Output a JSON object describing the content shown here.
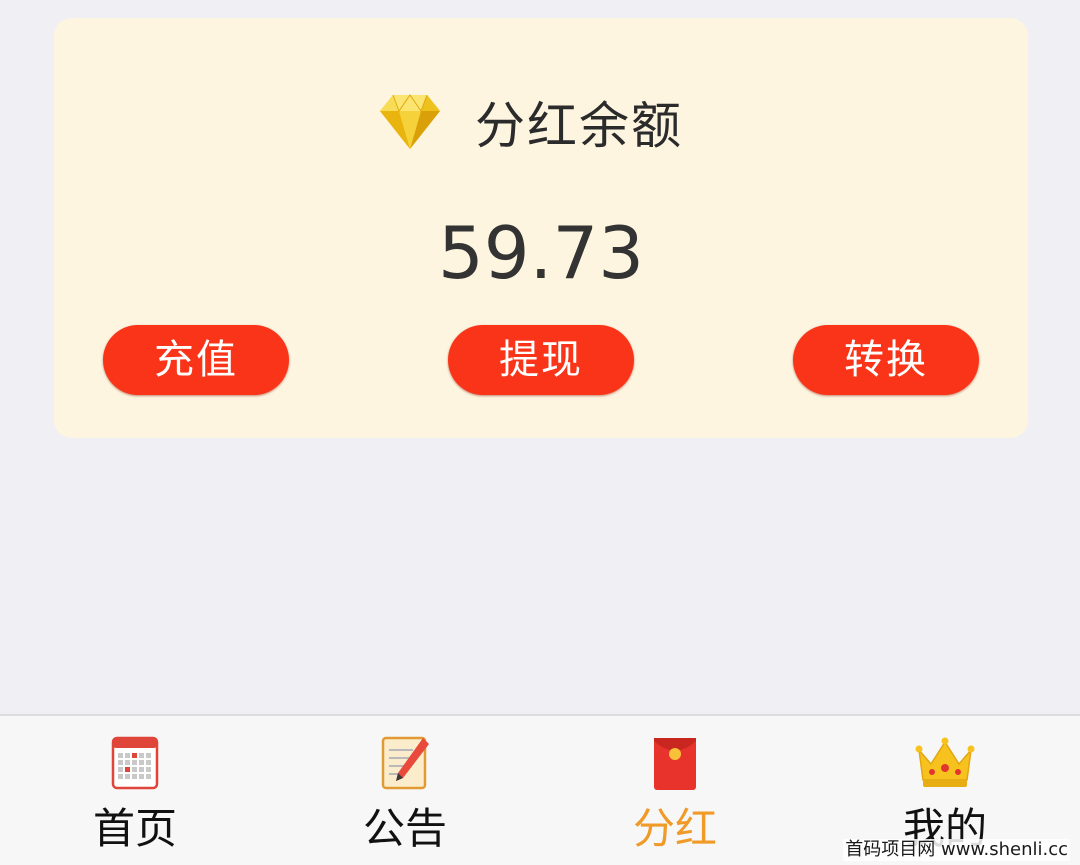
{
  "balance_card": {
    "icon": "diamond-icon",
    "title": "分红余额",
    "amount": "59.73",
    "buttons": {
      "recharge": "充值",
      "withdraw": "提现",
      "convert": "转换"
    },
    "background_color": "#fdf5e0",
    "button_color": "#fa3418"
  },
  "tab_bar": {
    "tabs": [
      {
        "label": "首页",
        "icon": "calendar-icon",
        "active": false
      },
      {
        "label": "公告",
        "icon": "notepad-icon",
        "active": false
      },
      {
        "label": "分红",
        "icon": "red-envelope-icon",
        "active": true
      },
      {
        "label": "我的",
        "icon": "crown-icon",
        "active": false
      }
    ],
    "active_color": "#f09a28"
  },
  "watermark": "首码项目网  www.shenli.cc"
}
